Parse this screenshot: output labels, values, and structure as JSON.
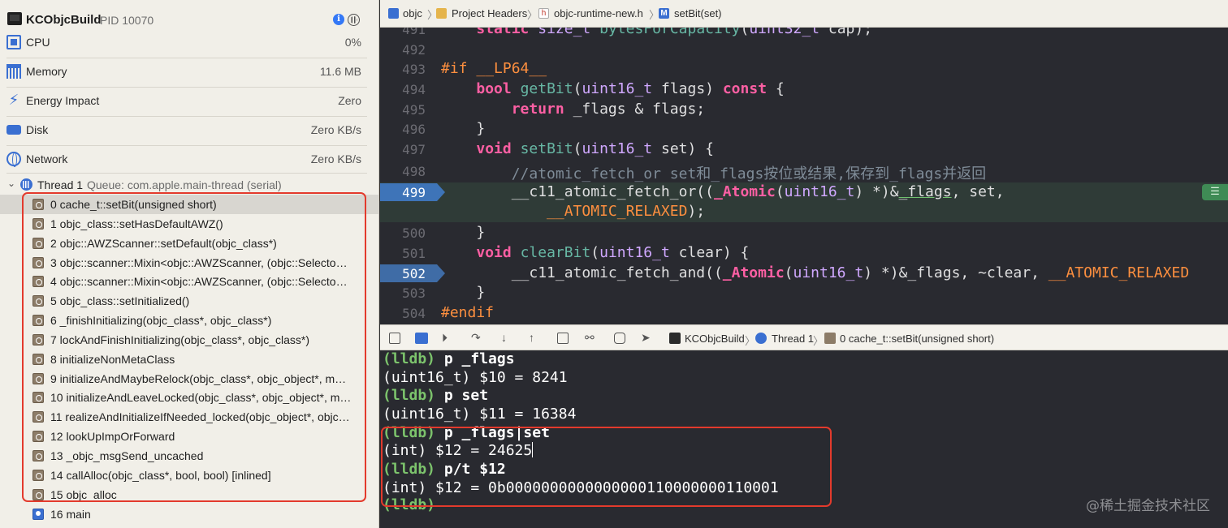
{
  "process": {
    "name": "KCObjcBuild",
    "pid": "PID 10070"
  },
  "gauges": [
    {
      "label": "CPU",
      "value": "0%"
    },
    {
      "label": "Memory",
      "value": "11.6 MB"
    },
    {
      "label": "Energy Impact",
      "value": "Zero"
    },
    {
      "label": "Disk",
      "value": "Zero KB/s"
    },
    {
      "label": "Network",
      "value": "Zero KB/s"
    }
  ],
  "thread": {
    "name": "Thread 1",
    "queue": "Queue: com.apple.main-thread (serial)"
  },
  "frames": [
    "0 cache_t::setBit(unsigned short)",
    "1 objc_class::setHasDefaultAWZ()",
    "2 objc::AWZScanner::setDefault(objc_class*)",
    "3 objc::scanner::Mixin<objc::AWZScanner, (objc::Selecto…",
    "4 objc::scanner::Mixin<objc::AWZScanner, (objc::Selecto…",
    "5 objc_class::setInitialized()",
    "6 _finishInitializing(objc_class*, objc_class*)",
    "7 lockAndFinishInitializing(objc_class*, objc_class*)",
    "8 initializeNonMetaClass",
    "9 initializeAndMaybeRelock(objc_class*, objc_object*, m…",
    "10 initializeAndLeaveLocked(objc_class*, objc_object*, m…",
    "11 realizeAndInitializeIfNeeded_locked(objc_object*, objc…",
    "12 lookUpImpOrForward",
    "13 _objc_msgSend_uncached",
    "14 callAlloc(objc_class*, bool, bool) [inlined]",
    "15 objc_alloc",
    "16 main"
  ],
  "breadcrumb": [
    "objc",
    "Project Headers",
    "objc-runtime-new.h",
    "setBit(set)"
  ],
  "line_numbers": [
    "491",
    "492",
    "493",
    "494",
    "495",
    "496",
    "497",
    "498",
    "499",
    "500",
    "501",
    "502",
    "503",
    "504"
  ],
  "code": {
    "l491": {
      "kw": "static",
      "ty": "size_t",
      "fn": "bytesForCapacity",
      "paren": "(",
      "ty2": "uint32_t",
      "rest": " cap);"
    },
    "l493": {
      "pp": "#if",
      "mac": "__LP64__"
    },
    "l494": {
      "kw": "bool",
      "fn": "getBit",
      "open": "(",
      "ty": "uint16_t",
      "rest": " flags) ",
      "kw2": "const",
      "close": " {"
    },
    "l495": {
      "kw": "return",
      "rest": " _flags & flags;"
    },
    "l496": {
      "text": "}"
    },
    "l497": {
      "kw": "void",
      "fn": "setBit",
      "open": "(",
      "ty": "uint16_t",
      "rest": " set) {"
    },
    "l498": {
      "comment": "//atomic_fetch_or set和_flags按位或结果,保存到_flags并返回"
    },
    "l499": {
      "a": "__c11_atomic_fetch_or((",
      "kw": "_Atomic",
      "b": "(",
      "ty": "uint16_t",
      "c": ") *)&",
      "flags": "_flags",
      "d": ", set,"
    },
    "l499b": {
      "mac": "__ATOMIC_RELAXED",
      "rest": ");"
    },
    "l500": {
      "text": "}"
    },
    "l501": {
      "kw": "void",
      "fn": "clearBit",
      "open": "(",
      "ty": "uint16_t",
      "rest": " clear) {"
    },
    "l502": {
      "a": "__c11_atomic_fetch_and((",
      "kw": "_Atomic",
      "b": "(",
      "ty": "uint16_t",
      "c": ") *)&_flags, ~clear, ",
      "mac": "__ATOMIC_RELAXED"
    },
    "l503": {
      "text": "}"
    },
    "l504": {
      "pp": "#endif"
    }
  },
  "debug_bar": {
    "target": "KCObjcBuild",
    "thread": "Thread 1",
    "frame": "0 cache_t::setBit(unsigned short)"
  },
  "console": {
    "prompt": "(lldb)",
    "lines": [
      {
        "type": "cmd",
        "text": " p _flags"
      },
      {
        "type": "out",
        "text": "(uint16_t) $10 = 8241"
      },
      {
        "type": "cmd",
        "text": " p set"
      },
      {
        "type": "out",
        "text": "(uint16_t) $11 = 16384"
      },
      {
        "type": "cmd",
        "text": " p _flags|set"
      },
      {
        "type": "out",
        "text": "(int) $12 = 24625"
      },
      {
        "type": "cmd",
        "text": " p/t $12"
      },
      {
        "type": "out",
        "text": "(int) $12 = 0b0000000000000000110000000110001"
      }
    ]
  },
  "watermark": "@稀土掘金技术社区",
  "colors": {
    "highlight_box": "#e33a2c",
    "breakpoint": "#3f6ca6",
    "lldb_prompt": "#7cc36c"
  }
}
